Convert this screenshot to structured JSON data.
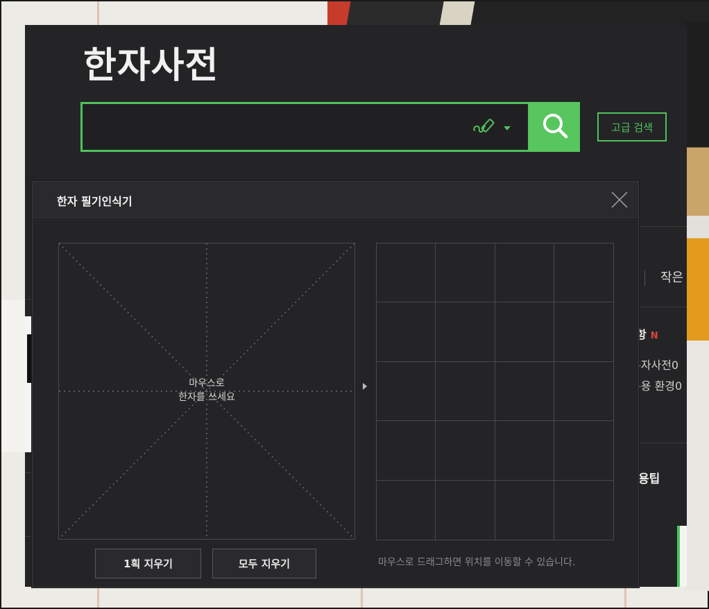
{
  "header": {
    "title": "한자사전"
  },
  "search": {
    "value": "",
    "placeholder": "",
    "advanced_label": "고급 검색"
  },
  "sidebar_partial": {
    "font_size_label": "작은",
    "notice_title": "항",
    "notice_badge": "N",
    "notice_line1": "-자사전0",
    "notice_line2": "-용 환경0",
    "tip_title": "용팁"
  },
  "handwriting_popup": {
    "title": "한자 필기인식기",
    "canvas_hint_line1": "마우스로",
    "canvas_hint_line2": "한자를 쓰세요",
    "undo_stroke_label": "1획 지우기",
    "clear_all_label": "모두 지우기",
    "drag_hint": "마우스로 드래그하면 위치를 이동할 수 있습니다."
  },
  "colors": {
    "accent": "#58c65f",
    "background": "#242426",
    "badge_new": "#e2453c"
  },
  "icons": {
    "handwrite": "handwrite-icon",
    "dropdown": "caret-down-icon",
    "search": "search-icon",
    "close": "close-icon"
  }
}
